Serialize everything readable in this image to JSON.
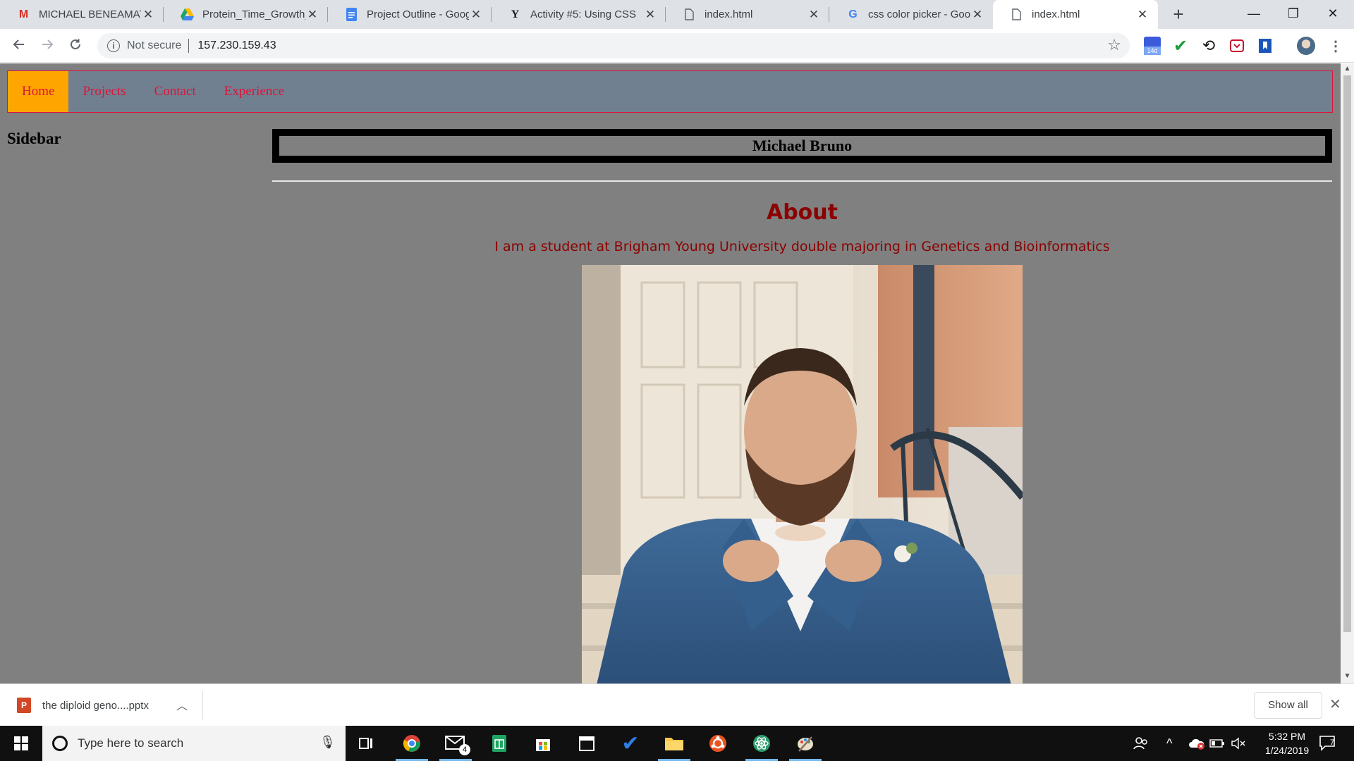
{
  "browser": {
    "tabs": [
      {
        "title": "MICHAEL BENEAMATO",
        "icon": "gmail-icon",
        "color": "#d93025"
      },
      {
        "title": "Protein_Time_Growth_E",
        "icon": "drive-icon",
        "color": "#1fa463"
      },
      {
        "title": "Project Outline - Goog",
        "icon": "docs-icon",
        "color": "#4285f4"
      },
      {
        "title": "Activity #5: Using CSS",
        "icon": "yahoo-icon",
        "color": "#202124"
      },
      {
        "title": "index.html",
        "icon": "file-icon",
        "color": "#5f6368"
      },
      {
        "title": "css color picker - Goog",
        "icon": "google-icon",
        "color": "#4285f4"
      },
      {
        "title": "index.html",
        "icon": "file-icon",
        "color": "#5f6368",
        "active": true
      }
    ],
    "address": {
      "security_label": "Not secure",
      "url": "157.230.159.43"
    },
    "extension_badge": "14d"
  },
  "page": {
    "nav": [
      {
        "label": "Home",
        "active": true
      },
      {
        "label": "Projects"
      },
      {
        "label": "Contact"
      },
      {
        "label": "Experience"
      }
    ],
    "sidebar_title": "Sidebar",
    "banner_name": "Michael Bruno",
    "about_heading": "About",
    "about_text": "I am a student at Brigham Young University double majoring in Genetics and Bioinformatics",
    "colors": {
      "background": "#808080",
      "nav_bg": "#708090",
      "nav_link": "#dc143c",
      "nav_active_bg": "#ffa500",
      "about_text": "#8b0000"
    }
  },
  "download_bar": {
    "file_name": "the diploid geno....pptx",
    "show_all_label": "Show all"
  },
  "taskbar": {
    "search_placeholder": "Type here to search",
    "mail_badge": "4",
    "time": "5:32 PM",
    "date": "1/24/2019",
    "notification_count": "7"
  }
}
